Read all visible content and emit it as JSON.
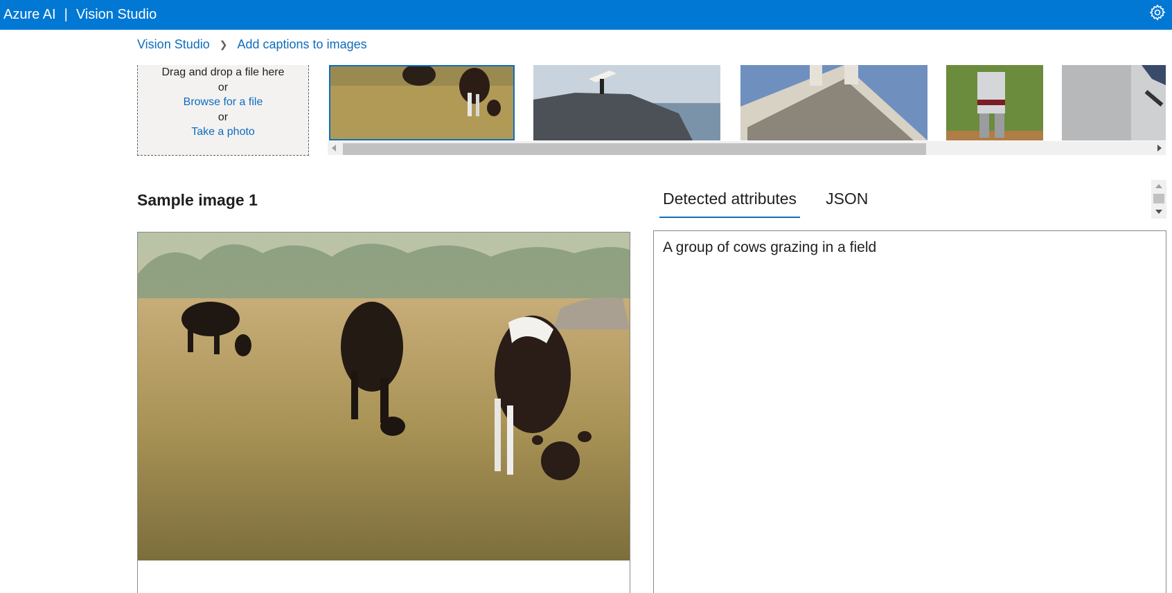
{
  "header": {
    "brand_primary": "Azure AI",
    "brand_separator": "|",
    "brand_secondary": "Vision Studio",
    "settings_icon": "gear-icon",
    "color": "#0078d4"
  },
  "breadcrumb": {
    "items": [
      "Vision Studio",
      "Add captions to images"
    ],
    "separator_icon": "chevron-right-icon"
  },
  "upload": {
    "drag_text": "Drag and drop a file here",
    "or_1": "or",
    "browse_link": "Browse for a file",
    "or_2": "or",
    "photo_link": "Take a photo"
  },
  "samples": {
    "thumbnails": [
      "cows-grazing",
      "surfer-on-rock",
      "building-pediment",
      "baseball-player",
      "skateboarder"
    ],
    "selected_index": 0
  },
  "sample_view": {
    "title": "Sample image 1"
  },
  "results": {
    "tabs": [
      "Detected attributes",
      "JSON"
    ],
    "active_tab": "Detected attributes",
    "caption": "A group of cows grazing in a field"
  }
}
